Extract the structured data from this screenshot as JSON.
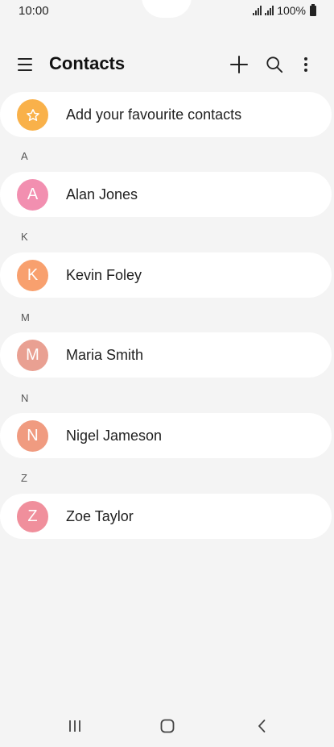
{
  "status_bar": {
    "time": "10:00",
    "battery": "100%"
  },
  "app_bar": {
    "title": "Contacts",
    "icons": [
      "menu-icon",
      "plus-icon",
      "search-icon",
      "more-vertical-icon"
    ]
  },
  "favourites": {
    "label": "Add your favourite contacts",
    "icon": "star-icon",
    "color": "#f9b14a"
  },
  "sections": [
    {
      "letter": "A",
      "contact": {
        "initial": "A",
        "name": "Alan Jones",
        "color": "#f28fb0"
      }
    },
    {
      "letter": "K",
      "contact": {
        "initial": "K",
        "name": "Kevin Foley",
        "color": "#f8a06e"
      }
    },
    {
      "letter": "M",
      "contact": {
        "initial": "M",
        "name": "Maria Smith",
        "color": "#e9a092"
      }
    },
    {
      "letter": "N",
      "contact": {
        "initial": "N",
        "name": "Nigel Jameson",
        "color": "#f09b80"
      }
    },
    {
      "letter": "Z",
      "contact": {
        "initial": "Z",
        "name": "Zoe Taylor",
        "color": "#f08f9c"
      }
    }
  ],
  "nav_bar": {
    "icons": [
      "recents-icon",
      "home-icon",
      "back-icon"
    ]
  }
}
